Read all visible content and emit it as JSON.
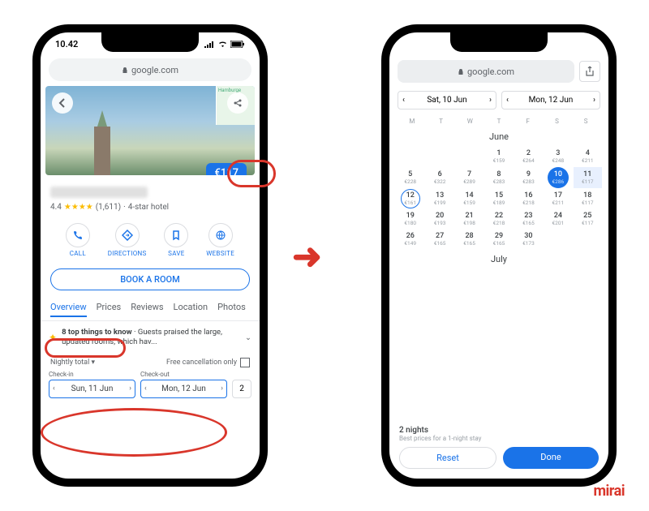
{
  "status": {
    "time": "10.42"
  },
  "url": "google.com",
  "hero": {
    "price": "€117",
    "map_text": "Hamburge"
  },
  "hotel": {
    "rating": "4.4",
    "stars": "★★★★",
    "reviews": "(1,611)",
    "category": "4-star hotel"
  },
  "actions": [
    {
      "label": "CALL"
    },
    {
      "label": "DIRECTIONS"
    },
    {
      "label": "SAVE"
    },
    {
      "label": "WEBSITE"
    }
  ],
  "book_label": "BOOK A ROOM",
  "tabs": [
    "Overview",
    "Prices",
    "Reviews",
    "Location",
    "Photos"
  ],
  "tip": {
    "title": "8 top things to know",
    "body": "Guests praised the large, updated rooms, which hav..."
  },
  "filter": {
    "nightly": "Nightly total",
    "free_cancel": "Free cancellation only"
  },
  "dates": {
    "checkin_label": "Check-in",
    "checkout_label": "Check-out",
    "checkin": "Sun, 11 Jun",
    "checkout": "Mon, 12 Jun",
    "guests": "2"
  },
  "calendar": {
    "pill_in": "Sat, 10 Jun",
    "pill_out": "Mon, 12 Jun",
    "dow": [
      "M",
      "T",
      "W",
      "T",
      "F",
      "S",
      "S"
    ],
    "month1": "June",
    "month2": "July",
    "days": [
      {
        "n": "",
        "p": "",
        "col": 0
      },
      {
        "n": "",
        "p": ""
      },
      {
        "n": "",
        "p": ""
      },
      {
        "n": "1",
        "p": "€159"
      },
      {
        "n": "2",
        "p": "€264"
      },
      {
        "n": "3",
        "p": "€248"
      },
      {
        "n": "4",
        "p": "€211"
      },
      {
        "n": "5",
        "p": "€228"
      },
      {
        "n": "6",
        "p": "€322"
      },
      {
        "n": "7",
        "p": "€289"
      },
      {
        "n": "8",
        "p": "€283"
      },
      {
        "n": "9",
        "p": "€283"
      },
      {
        "n": "10",
        "p": "€286",
        "sel": true
      },
      {
        "n": "11",
        "p": "€117",
        "range": true
      },
      {
        "n": "12",
        "p": "€161",
        "out": true
      },
      {
        "n": "13",
        "p": "€199"
      },
      {
        "n": "14",
        "p": "€159"
      },
      {
        "n": "15",
        "p": "€189"
      },
      {
        "n": "16",
        "p": "€218"
      },
      {
        "n": "17",
        "p": "€211"
      },
      {
        "n": "18",
        "p": "€117"
      },
      {
        "n": "19",
        "p": "€180"
      },
      {
        "n": "20",
        "p": "€193"
      },
      {
        "n": "21",
        "p": "€198"
      },
      {
        "n": "22",
        "p": "€218"
      },
      {
        "n": "23",
        "p": "€165"
      },
      {
        "n": "24",
        "p": "€201"
      },
      {
        "n": "25",
        "p": "€117"
      },
      {
        "n": "26",
        "p": "€149"
      },
      {
        "n": "27",
        "p": "€165"
      },
      {
        "n": "28",
        "p": "€165"
      },
      {
        "n": "29",
        "p": "€165"
      },
      {
        "n": "30",
        "p": "€173"
      },
      {
        "n": "",
        "p": ""
      },
      {
        "n": "",
        "p": ""
      }
    ]
  },
  "footer": {
    "nights": "2 nights",
    "sub": "Best prices for a 1-night stay",
    "reset": "Reset",
    "done": "Done"
  },
  "brand": "mirai"
}
